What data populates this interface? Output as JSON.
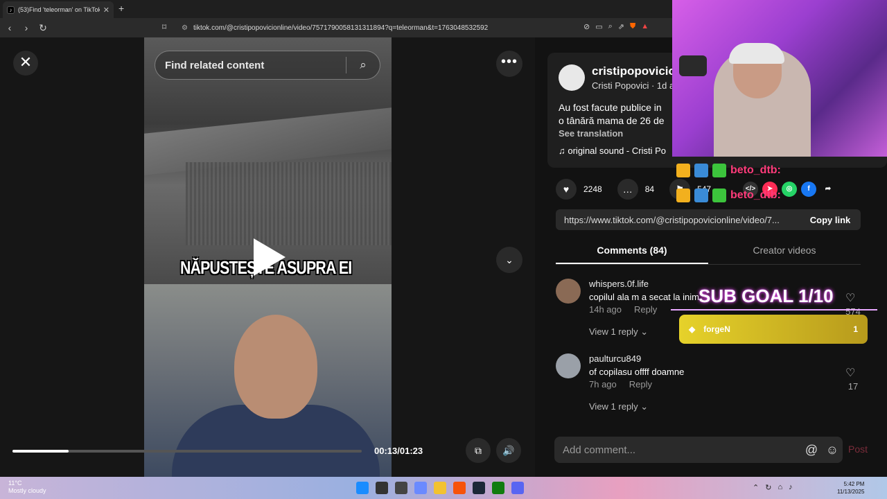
{
  "browser": {
    "tab_title": "(53)Find 'teleorman' on TikTok |",
    "url": "tiktok.com/@cristipopovicionline/video/7571790058131311894?q=teleorman&t=1763048532592"
  },
  "player": {
    "search_placeholder": "Find related content",
    "caption_text": "NĂPUSTEȘTE ASUPRA EI",
    "time": "00:13/01:23",
    "progress_fraction": 0.16
  },
  "post": {
    "username": "cristipopovicionline",
    "display_line": "Cristi Popovici · 1d ago",
    "desc_line1": "Au fost facute publice in",
    "desc_line2": "o tânără mama de 26 de",
    "see_translation": "See translation",
    "sound": "original sound - Cristi Po",
    "likes": "2248",
    "comments": "84",
    "saves": "547",
    "link": "https://www.tiktok.com/@cristipopovicionline/video/7...",
    "copy_link": "Copy link"
  },
  "tabs": {
    "comments": "Comments (84)",
    "creator": "Creator videos"
  },
  "comments": [
    {
      "user": "whispers.0f.life",
      "text": "copilul ala m a secat la inim",
      "time": "14h ago",
      "reply": "Reply",
      "view": "View 1 reply",
      "likes": "574"
    },
    {
      "user": "paulturcu849",
      "text": "of copilasu offff doamne",
      "time": "7h ago",
      "reply": "Reply",
      "view": "View 1 reply",
      "likes": "17"
    }
  ],
  "compose": {
    "placeholder": "Add comment...",
    "post": "Post"
  },
  "overlay": {
    "chat_user": "beto_dtb:",
    "sub_goal": "SUB GOAL 1/10",
    "goal_name": "forgeN",
    "goal_count": "1"
  },
  "taskbar": {
    "temp": "11°C",
    "weather": "Mostly cloudy",
    "time": "5:42 PM",
    "date": "11/13/2025"
  }
}
